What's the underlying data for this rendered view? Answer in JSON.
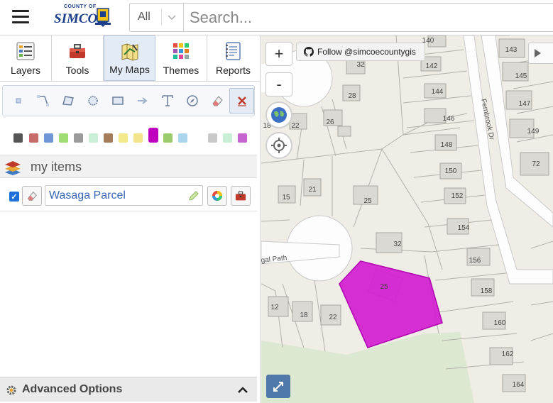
{
  "header": {
    "menu_icon": "hamburger-menu-icon",
    "logo": {
      "top_text": "COUNTY OF",
      "main_text": "SIMCOE"
    },
    "search": {
      "category": "All",
      "placeholder": "Search..."
    }
  },
  "tabs": [
    {
      "label": "Layers",
      "icon": "layers-list-icon"
    },
    {
      "label": "Tools",
      "icon": "toolbox-icon"
    },
    {
      "label": "My Maps",
      "icon": "my-maps-icon",
      "active": true
    },
    {
      "label": "Themes",
      "icon": "themes-grid-icon"
    },
    {
      "label": "Reports",
      "icon": "reports-notebook-icon"
    }
  ],
  "draw_tools": [
    "point",
    "line",
    "polygon",
    "circle",
    "rectangle",
    "arrow",
    "text",
    "measure",
    "eraser",
    "clear"
  ],
  "colors": [
    "#555555",
    "#c66a6a",
    "#6f97d6",
    "#9fdc74",
    "#9b9b9b",
    "#c9efd6",
    "#a47c5a",
    "#f3e88a",
    "#f2e58c",
    "#bf00bf",
    "#9bcc6b",
    "#a9d6ec",
    "#c9c9c9",
    "#c9f0d6",
    "#c765d0"
  ],
  "selected_color": "#bf00bf",
  "my_items": {
    "title": "my items",
    "items": [
      {
        "name": "Wasaga Parcel",
        "checked": true
      }
    ]
  },
  "advanced": {
    "label": "Advanced Options"
  },
  "map": {
    "zoom_in": "+",
    "zoom_out": "-",
    "follow_text": "Follow @simcoecountygis",
    "street_labels": [
      "Fernbrook Dr",
      "gal Path"
    ],
    "lot_numbers": [
      "140",
      "143",
      "142",
      "145",
      "144",
      "147",
      "146",
      "149",
      "148",
      "72",
      "150",
      "152",
      "154",
      "156",
      "158",
      "160",
      "162",
      "164",
      "32",
      "28",
      "26",
      "22",
      "18",
      "21",
      "15",
      "25",
      "32",
      "25",
      "12",
      "18",
      "22"
    ],
    "parcel_color": "#d21ed2"
  }
}
